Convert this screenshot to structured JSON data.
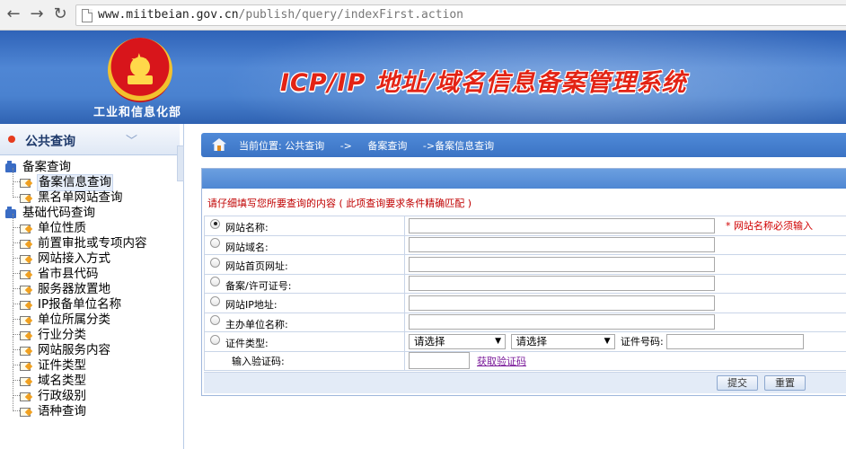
{
  "browser": {
    "url_host": "www.miitbeian.gov.cn",
    "url_path": "/publish/query/indexFirst.action"
  },
  "header": {
    "ministry": "工业和信息化部",
    "title": "ICP/IP 地址/域名信息备案管理系统"
  },
  "sidebar": {
    "title": "公共查询",
    "groups": [
      {
        "label": "备案查询",
        "items": [
          "备案信息查询",
          "黑名单网站查询"
        ]
      },
      {
        "label": "基础代码查询",
        "items": [
          "单位性质",
          "前置审批或专项内容",
          "网站接入方式",
          "省市县代码",
          "服务器放置地",
          "IP报备单位名称",
          "单位所属分类",
          "行业分类",
          "网站服务内容",
          "证件类型",
          "域名类型",
          "行政级别",
          "语种查询"
        ]
      }
    ]
  },
  "breadcrumb": {
    "current": "当前位置: 公共查询",
    "sep1": "->",
    "level1": "备案查询",
    "level2": "->备案信息查询"
  },
  "form": {
    "notice": "请仔细填写您所要查询的内容 ( 此项查询要求条件精确匹配 )",
    "fields": [
      {
        "label": "网站名称:",
        "required_note": "* 网站名称必须输入"
      },
      {
        "label": "网站域名:"
      },
      {
        "label": "网站首页网址:"
      },
      {
        "label": "备案/许可证号:"
      },
      {
        "label": "网站IP地址:"
      },
      {
        "label": "主办单位名称:"
      },
      {
        "label": "证件类型:"
      }
    ],
    "cert_select1": "请选择",
    "cert_select2": "请选择",
    "cert_number_label": "证件号码:",
    "captcha_label": "输入验证码:",
    "captcha_link": "获取验证码",
    "submit_label": "提交",
    "reset_label": "重置"
  }
}
